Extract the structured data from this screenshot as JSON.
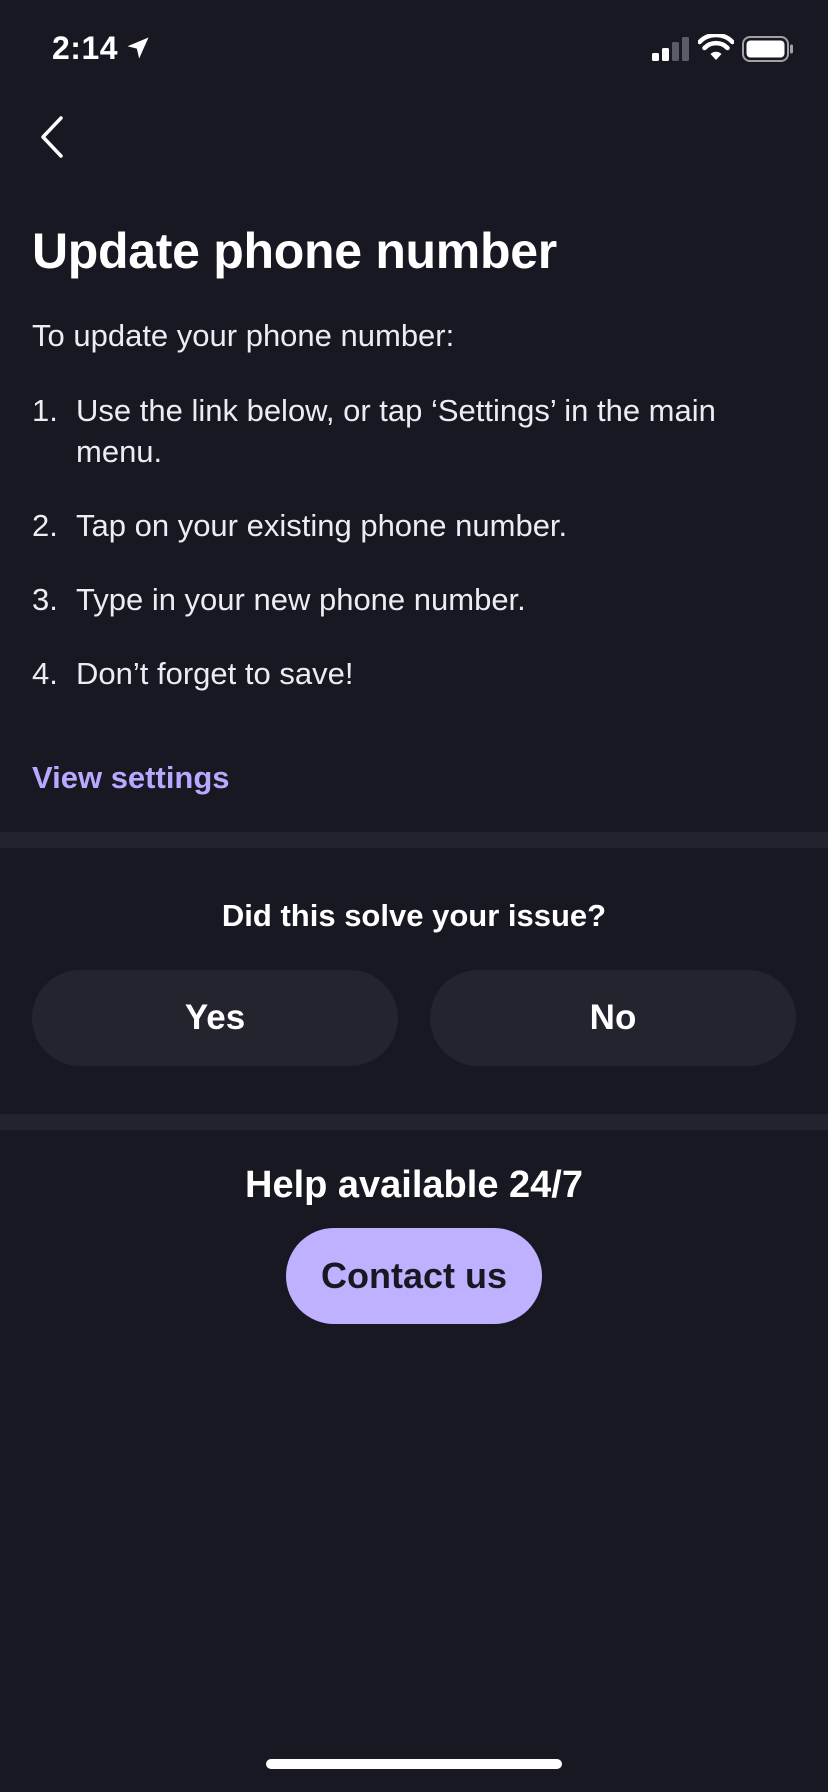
{
  "status_bar": {
    "time": "2:14",
    "icons": [
      "location-arrow-icon",
      "signal-icon",
      "wifi-icon",
      "battery-icon"
    ]
  },
  "nav": {
    "back_icon": "chevron-left-icon"
  },
  "article": {
    "title": "Update phone number",
    "intro": "To update your phone number:",
    "steps": [
      {
        "num": "1.",
        "text": "Use the link below, or tap ‘Settings’ in the main menu."
      },
      {
        "num": "2.",
        "text": "Tap on your existing phone number."
      },
      {
        "num": "3.",
        "text": "Type in your new phone number."
      },
      {
        "num": "4.",
        "text": "Don’t forget to save!"
      }
    ],
    "link_label": "View settings"
  },
  "feedback": {
    "question": "Did this solve your issue?",
    "yes_label": "Yes",
    "no_label": "No"
  },
  "help": {
    "title": "Help available 24/7",
    "contact_label": "Contact us"
  },
  "colors": {
    "background": "#171821",
    "surface": "#23242e",
    "accent": "#b9a8ff",
    "accent_button": "#bfb1ff"
  }
}
